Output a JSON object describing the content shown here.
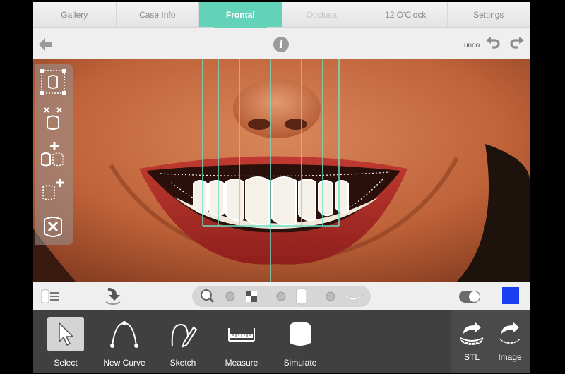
{
  "tabs": [
    {
      "label": "Gallery",
      "state": "normal"
    },
    {
      "label": "Case Info",
      "state": "normal"
    },
    {
      "label": "Frontal",
      "state": "active"
    },
    {
      "label": "Occlusal",
      "state": "disabled"
    },
    {
      "label": "12 O'Clock",
      "state": "normal"
    },
    {
      "label": "Settings",
      "state": "normal"
    }
  ],
  "toolbar": {
    "back_icon": "arrow-left-icon",
    "info_label": "i",
    "undo_label": "undo",
    "undo_icon": "undo-arrow-icon",
    "redo_icon": "redo-arrow-icon"
  },
  "side_tools": [
    {
      "name": "select-tooth-icon"
    },
    {
      "name": "move-tooth-icon"
    },
    {
      "name": "add-tooth-icon"
    },
    {
      "name": "add-curve-tooth-icon"
    },
    {
      "name": "delete-tooth-icon"
    }
  ],
  "midbar": {
    "layers_icon": "layers-icon",
    "download_icon": "download-arrow-icon",
    "view_options": [
      "zoom-icon",
      "checker-icon",
      "tooth-icon",
      "smile-teeth-icon"
    ],
    "toggle_on": true,
    "swatch_color": "#1a3ef0"
  },
  "bottom_tools": [
    {
      "label": "Select",
      "icon": "cursor-arrow-icon",
      "selected": true
    },
    {
      "label": "New Curve",
      "icon": "curve-icon",
      "selected": false
    },
    {
      "label": "Sketch",
      "icon": "sketch-pencil-icon",
      "selected": false
    },
    {
      "label": "Measure",
      "icon": "ruler-icon",
      "selected": false
    },
    {
      "label": "Simulate",
      "icon": "simulate-tooth-icon",
      "selected": false
    }
  ],
  "exports": [
    {
      "label": "STL",
      "icon": "export-stl-icon"
    },
    {
      "label": "Image",
      "icon": "export-image-icon"
    }
  ],
  "colors": {
    "accent": "#62d3b8",
    "guide_lines": "#6fe0c4",
    "bottom_bar": "#404040",
    "swatch": "#1a3ef0"
  }
}
